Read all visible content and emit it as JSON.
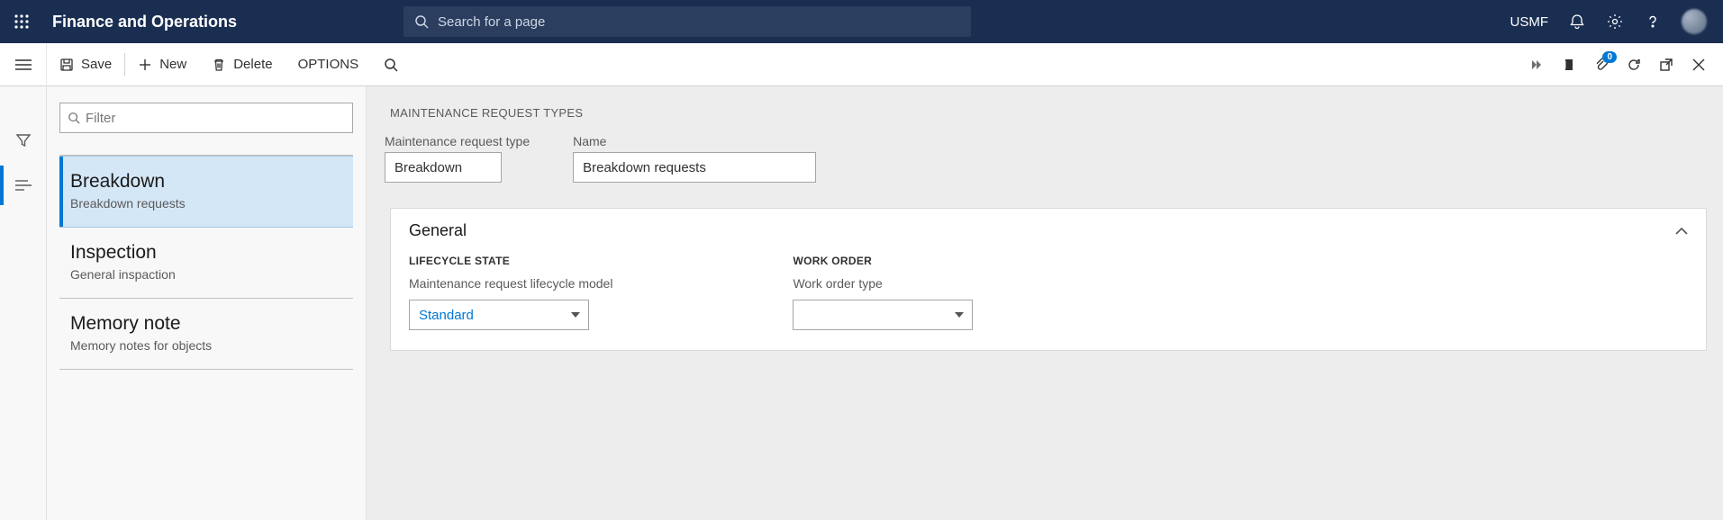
{
  "header": {
    "app_title": "Finance and Operations",
    "search_placeholder": "Search for a page",
    "company": "USMF"
  },
  "actionbar": {
    "save": "Save",
    "new": "New",
    "delete": "Delete",
    "options": "OPTIONS",
    "attach_count": "0"
  },
  "list": {
    "filter_placeholder": "Filter",
    "items": [
      {
        "title": "Breakdown",
        "subtitle": "Breakdown requests",
        "selected": true
      },
      {
        "title": "Inspection",
        "subtitle": "General inspaction",
        "selected": false
      },
      {
        "title": "Memory note",
        "subtitle": "Memory notes for objects",
        "selected": false
      }
    ]
  },
  "detail": {
    "page_heading": "MAINTENANCE REQUEST TYPES",
    "fields": {
      "type_label": "Maintenance request type",
      "type_value": "Breakdown",
      "name_label": "Name",
      "name_value": "Breakdown requests"
    },
    "general": {
      "card_title": "General",
      "lifecycle_header": "LIFECYCLE STATE",
      "lifecycle_label": "Maintenance request lifecycle model",
      "lifecycle_value": "Standard",
      "workorder_header": "WORK ORDER",
      "workorder_label": "Work order type",
      "workorder_value": ""
    }
  }
}
